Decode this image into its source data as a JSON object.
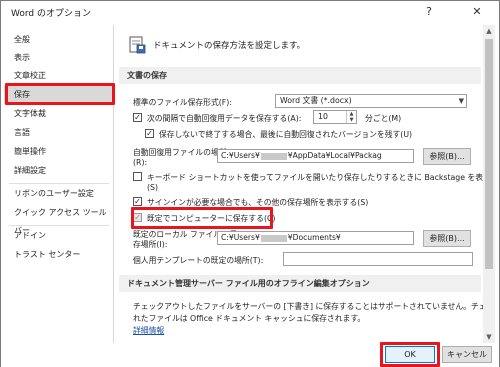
{
  "window": {
    "title": "Word のオプション",
    "help_label": "?",
    "close_label": "✕"
  },
  "sidebar": {
    "items": [
      {
        "label": "全般"
      },
      {
        "label": "表示"
      },
      {
        "label": "文章校正"
      },
      {
        "label": "保存"
      },
      {
        "label": "文字体裁"
      },
      {
        "label": "言語"
      },
      {
        "label": "簡単操作"
      },
      {
        "label": "詳細設定"
      },
      {
        "label": "リボンのユーザー設定"
      },
      {
        "label": "クイック アクセス ツール バー"
      },
      {
        "label": "アドイン"
      },
      {
        "label": "トラスト センター"
      }
    ],
    "selected": "保存"
  },
  "main": {
    "header": "ドキュメントの保存方法を設定します。",
    "section_save": "文書の保存",
    "format_label": "標準のファイル保存形式(F):",
    "format_value": "Word 文書 (*.docx)",
    "autorecover_label": "次の間隔で自動回復用データを保存する(A):",
    "autorecover_minutes": "10",
    "minutes_unit": "分ごと(M)",
    "keep_last_label": "保存しないで終了する場合、最後に自動回復されたバージョンを残す(U)",
    "autorecover_path_label": "自動回復用ファイルの場所",
    "autorecover_path_key": "(R):",
    "autorecover_path_prefix": "C:¥Users¥",
    "autorecover_path_suffix": "¥AppData¥Local¥Packag",
    "browse_label": "参照(B)...",
    "keyboard_shortcut_label": "キーボード ショートカットを使ってファイルを開いたり保存したりするときに Backstage を表示しない",
    "keyboard_shortcut_key": "(S)",
    "extra_places_label": "サインインが必要な場合でも、その他の保存場所を表示する(S)",
    "default_computer_label": "既定でコンピューターに保存する(C)",
    "default_local_label_1": "既定のローカル ファイルの保",
    "default_local_label_2": "存場所(I):",
    "default_local_prefix": "C:¥Users¥",
    "default_local_suffix": "¥Documents¥",
    "browse2_label": "参照(B)...",
    "template_label": "個人用テンプレートの既定の場所(T):",
    "section_offline": "ドキュメント管理サーバー ファイル用のオフライン編集オプション",
    "offline_text_1": "チェックアウトしたファイルをサーバーの [下書き] に保存することはサポートされていません。チェックアウトさ",
    "offline_text_2": "れたファイルは Office ドキュメント キャッシュに保存されます。",
    "details_link": "詳細情報"
  },
  "footer": {
    "ok_label": "OK",
    "cancel_label": "キャンセル"
  }
}
